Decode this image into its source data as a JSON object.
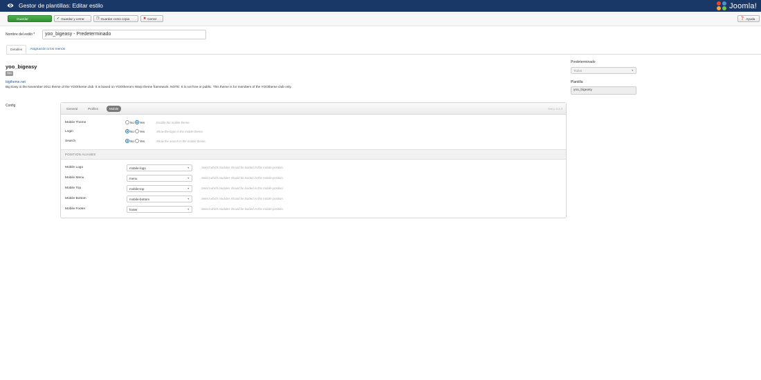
{
  "header": {
    "title": "Gestor de plantillas: Editar estilo",
    "logo_text": "Joomla!"
  },
  "toolbar": {
    "save_label": "Guardar",
    "save_close_label": "Guardar y cerrar",
    "save_copy_label": "Guardar como copia",
    "close_label": "Cerrar",
    "help_label": "Ayuda"
  },
  "form": {
    "style_name_label": "Nombre del estilo *",
    "style_name_value": "yoo_bigeasy - Predeterminado"
  },
  "tabs": [
    {
      "label": "Detalles",
      "active": true
    },
    {
      "label": "Asignación a los menús",
      "active": false
    }
  ],
  "template": {
    "name": "yoo_bigeasy",
    "badge": "Sitio",
    "link": "bigtheme.net",
    "description": "Big Easy is the November 2011 theme of the YOOtheme club. It is based on YOOtheme's Warp theme framework. NOTE: It is not free or public. This theme is for members of the YOOtheme club only."
  },
  "sidebar": {
    "default_label": "Predeterminado",
    "default_value": "Todos",
    "template_label": "Plantilla",
    "template_value": "yoo_bigeasy"
  },
  "config": {
    "label": "Config",
    "tabs": [
      {
        "label": "General",
        "active": false
      },
      {
        "label": "Profiles",
        "active": false
      },
      {
        "label": "Mobile",
        "active": true
      }
    ],
    "version": "Warp 6.3.0",
    "toggles": [
      {
        "label": "Mobile Theme",
        "no": "No",
        "yes": "Yes",
        "selected": "yes",
        "hint": "Enable the mobile theme."
      },
      {
        "label": "Login",
        "no": "No",
        "yes": "Yes",
        "selected": "no",
        "hint": "Show the login in the mobile theme."
      },
      {
        "label": "Search",
        "no": "No",
        "yes": "Yes",
        "selected": "no",
        "hint": "Show the search in the mobile theme."
      }
    ],
    "section_title": "POSITION ALIASES",
    "aliases": [
      {
        "label": "Mobile Logo",
        "value": "mobile-logo",
        "hint": "Select which modules should be loaded in this mobile position."
      },
      {
        "label": "Mobile Menu",
        "value": "menu",
        "hint": "Select which modules should be loaded in this mobile position."
      },
      {
        "label": "Mobile Top",
        "value": "mobile-top",
        "hint": "Select which modules should be loaded in this mobile position."
      },
      {
        "label": "Mobile Bottom",
        "value": "mobile-bottom",
        "hint": "Select which modules should be loaded in this mobile position."
      },
      {
        "label": "Mobile Footer",
        "value": "footer",
        "hint": "Select which modules should be loaded in this mobile position."
      }
    ]
  },
  "colors": {
    "header_bg": "#1a3867",
    "save_button": "#3a9d3a",
    "link": "#1f5fa0",
    "radio_selected": "#1f6fbf"
  },
  "icons": {
    "header": "eye-icon",
    "save_close": "check-icon",
    "save_copy": "copy-icon",
    "close": "x-circle-icon",
    "help": "question-icon"
  }
}
